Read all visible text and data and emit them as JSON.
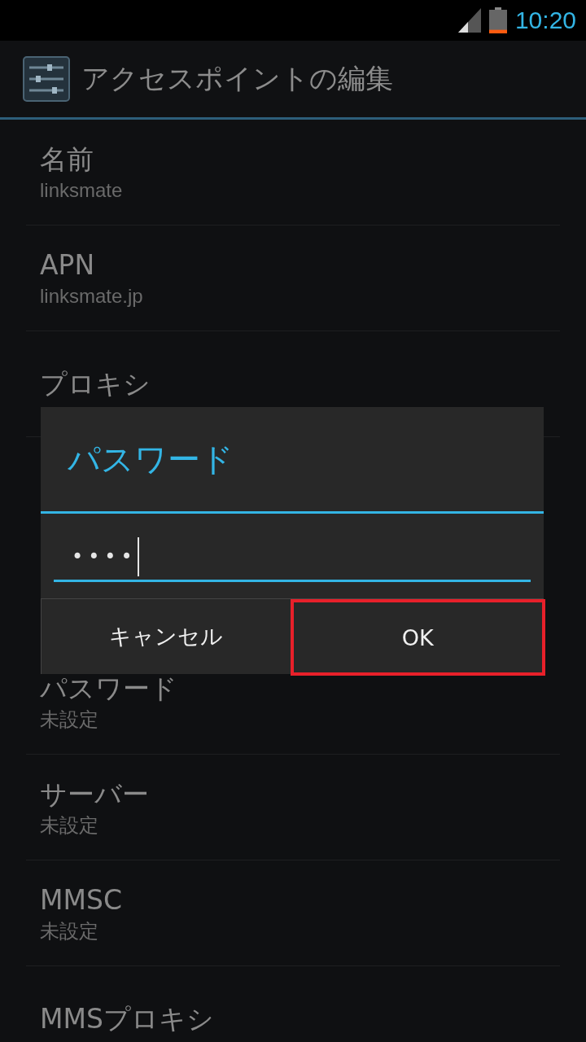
{
  "status_bar": {
    "time": "10:20"
  },
  "action_bar": {
    "title": "アクセスポイントの編集"
  },
  "settings": [
    {
      "title": "名前",
      "summary": "linksmate"
    },
    {
      "title": "APN",
      "summary": "linksmate.jp"
    },
    {
      "title": "プロキシ"
    },
    {
      "title": "パスワード",
      "summary": "未設定",
      "after_hidden": true
    },
    {
      "title": "サーバー",
      "summary": "未設定"
    },
    {
      "title": "MMSC",
      "summary": "未設定"
    },
    {
      "title": "MMSプロキシ"
    }
  ],
  "dialog": {
    "title": "パスワード",
    "field": {
      "value": "••••"
    },
    "buttons": [
      {
        "label": "キャンセル",
        "highlighted": false
      },
      {
        "label": "OK",
        "highlighted": true
      }
    ]
  }
}
